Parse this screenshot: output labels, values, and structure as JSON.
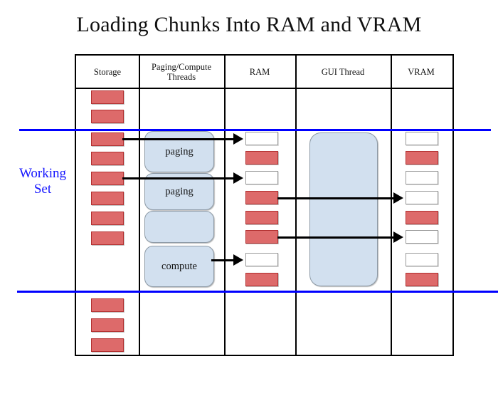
{
  "title": "Loading Chunks Into RAM and VRAM",
  "annotation": {
    "working_set_label": "Working\nSet",
    "working_set_line_color": "#0000ff"
  },
  "colors": {
    "filled_chunk": "#dd6a6a",
    "filled_chunk_border": "#b23030",
    "empty_chunk": "#ffffff",
    "empty_chunk_border": "#9a9a9a",
    "process_box": "#d2e0ef",
    "process_box_border": "#8d9aa6",
    "grid": "#000000",
    "accent_blue": "#0000ff"
  },
  "table": {
    "columns": [
      {
        "key": "storage",
        "header": "Storage"
      },
      {
        "key": "threads",
        "header": "Paging/Compute Threads"
      },
      {
        "key": "ram",
        "header": "RAM"
      },
      {
        "key": "gui",
        "header": "GUI Thread"
      },
      {
        "key": "vram",
        "header": "VRAM"
      }
    ]
  },
  "columns": {
    "storage": {
      "chunks": [
        {
          "state": "filled"
        },
        {
          "state": "filled"
        },
        {
          "state": "filled"
        },
        {
          "state": "filled"
        },
        {
          "state": "filled"
        },
        {
          "state": "filled"
        },
        {
          "state": "filled"
        },
        {
          "state": "filled"
        },
        {
          "state": "filled"
        },
        {
          "state": "filled"
        },
        {
          "state": "filled"
        }
      ]
    },
    "threads": {
      "boxes": [
        {
          "label": "paging"
        },
        {
          "label": "paging"
        },
        {
          "label": ""
        },
        {
          "label": "compute"
        }
      ]
    },
    "ram": {
      "chunks": [
        {
          "state": "empty"
        },
        {
          "state": "filled"
        },
        {
          "state": "empty"
        },
        {
          "state": "filled"
        },
        {
          "state": "filled"
        },
        {
          "state": "filled"
        },
        {
          "state": "empty"
        },
        {
          "state": "filled"
        }
      ]
    },
    "gui": {
      "boxes": [
        {
          "label": ""
        }
      ]
    },
    "vram": {
      "chunks": [
        {
          "state": "empty"
        },
        {
          "state": "filled"
        },
        {
          "state": "empty"
        },
        {
          "state": "empty"
        },
        {
          "state": "filled"
        },
        {
          "state": "empty"
        },
        {
          "state": "empty"
        },
        {
          "state": "filled"
        }
      ]
    }
  },
  "arrows": [
    {
      "from": "storage-chunk-2",
      "to": "ram-chunk-0",
      "via": "paging"
    },
    {
      "from": "storage-chunk-4",
      "to": "ram-chunk-2",
      "via": "paging"
    },
    {
      "from": "compute",
      "to": "ram-chunk-6",
      "via": ""
    },
    {
      "from": "ram-chunk-3",
      "to": "vram-chunk-3",
      "via": "gui-thread"
    },
    {
      "from": "ram-chunk-5",
      "to": "vram-chunk-5",
      "via": "gui-thread"
    }
  ]
}
